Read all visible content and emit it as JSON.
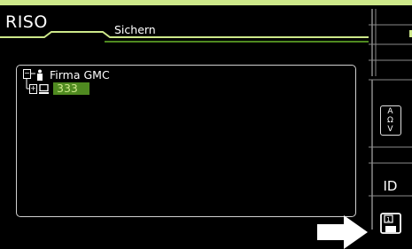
{
  "header": {
    "title": "RISO",
    "subtab": "Sichern"
  },
  "tree": {
    "items": [
      {
        "label": "Firma GMC",
        "icon": "person-icon",
        "expander": "−"
      },
      {
        "label": "333",
        "icon": "pc-icon",
        "expander": "+",
        "selected": true
      }
    ]
  },
  "sidebar": {
    "aov_label": [
      "A",
      "Ω",
      "V"
    ],
    "id_label": "ID",
    "save_number": "1"
  },
  "colors": {
    "accent": "#4f8a20",
    "accent_light": "#cde88a"
  }
}
